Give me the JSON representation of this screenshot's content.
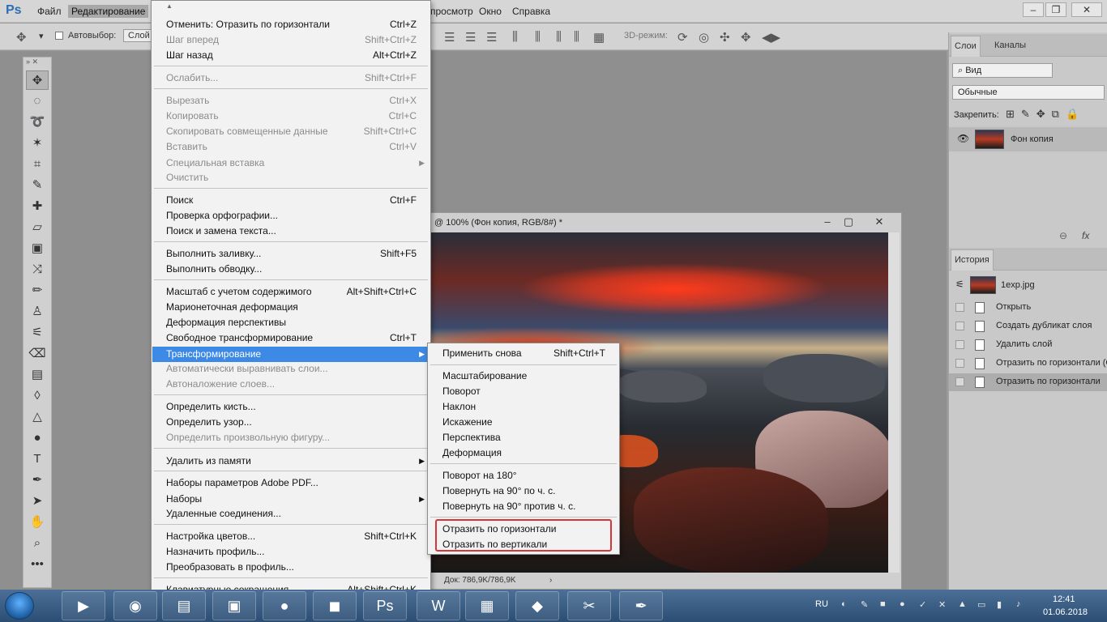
{
  "app": {
    "logo": "Ps",
    "menus": [
      "Файл",
      "Редактирование",
      "просмотр",
      "Окно",
      "Справка"
    ]
  },
  "options": {
    "autoselect": "Автовыбор:",
    "layer_select": "Слой",
    "mode_3d": "3D-режим:"
  },
  "edit_menu": {
    "items": [
      {
        "label": "Отменить: Отразить по горизонтали",
        "shortcut": "Ctrl+Z",
        "disabled": false
      },
      {
        "label": "Шаг вперед",
        "shortcut": "Shift+Ctrl+Z",
        "disabled": true
      },
      {
        "label": "Шаг назад",
        "shortcut": "Alt+Ctrl+Z",
        "disabled": false
      },
      {
        "label": "Ослабить...",
        "shortcut": "Shift+Ctrl+F",
        "disabled": true
      },
      {
        "label": "Вырезать",
        "shortcut": "Ctrl+X",
        "disabled": true
      },
      {
        "label": "Копировать",
        "shortcut": "Ctrl+C",
        "disabled": true
      },
      {
        "label": "Скопировать совмещенные данные",
        "shortcut": "Shift+Ctrl+C",
        "disabled": true
      },
      {
        "label": "Вставить",
        "shortcut": "Ctrl+V",
        "disabled": true
      },
      {
        "label": "Специальная вставка",
        "shortcut": "",
        "disabled": true
      },
      {
        "label": "Очистить",
        "shortcut": "",
        "disabled": true
      },
      {
        "label": "Поиск",
        "shortcut": "Ctrl+F",
        "disabled": false
      },
      {
        "label": "Проверка орфографии...",
        "shortcut": "",
        "disabled": false
      },
      {
        "label": "Поиск и замена текста...",
        "shortcut": "",
        "disabled": false
      },
      {
        "label": "Выполнить заливку...",
        "shortcut": "Shift+F5",
        "disabled": false
      },
      {
        "label": "Выполнить обводку...",
        "shortcut": "",
        "disabled": false
      },
      {
        "label": "Масштаб с учетом содержимого",
        "shortcut": "Alt+Shift+Ctrl+C",
        "disabled": false
      },
      {
        "label": "Марионеточная деформация",
        "shortcut": "",
        "disabled": false
      },
      {
        "label": "Деформация перспективы",
        "shortcut": "",
        "disabled": false
      },
      {
        "label": "Свободное трансформирование",
        "shortcut": "Ctrl+T",
        "disabled": false
      },
      {
        "label": "Трансформирование",
        "shortcut": "",
        "disabled": false
      },
      {
        "label": "Автоматически выравнивать слои...",
        "shortcut": "",
        "disabled": true
      },
      {
        "label": "Автоналожение слоев...",
        "shortcut": "",
        "disabled": true
      },
      {
        "label": "Определить кисть...",
        "shortcut": "",
        "disabled": false
      },
      {
        "label": "Определить узор...",
        "shortcut": "",
        "disabled": false
      },
      {
        "label": "Определить произвольную фигуру...",
        "shortcut": "",
        "disabled": true
      },
      {
        "label": "Удалить из памяти",
        "shortcut": "",
        "disabled": false
      },
      {
        "label": "Наборы параметров Adobe PDF...",
        "shortcut": "",
        "disabled": false
      },
      {
        "label": "Наборы",
        "shortcut": "",
        "disabled": false
      },
      {
        "label": "Удаленные соединения...",
        "shortcut": "",
        "disabled": false
      },
      {
        "label": "Настройка цветов...",
        "shortcut": "Shift+Ctrl+K",
        "disabled": false
      },
      {
        "label": "Назначить профиль...",
        "shortcut": "",
        "disabled": false
      },
      {
        "label": "Преобразовать в профиль...",
        "shortcut": "",
        "disabled": false
      },
      {
        "label": "Клавиатурные сокращения...",
        "shortcut": "Alt+Shift+Ctrl+K",
        "disabled": false
      }
    ]
  },
  "transform_menu": {
    "items": [
      {
        "label": "Применить снова",
        "shortcut": "Shift+Ctrl+T"
      },
      {
        "label": "Масштабирование",
        "shortcut": ""
      },
      {
        "label": "Поворот",
        "shortcut": ""
      },
      {
        "label": "Наклон",
        "shortcut": ""
      },
      {
        "label": "Искажение",
        "shortcut": ""
      },
      {
        "label": "Перспектива",
        "shortcut": ""
      },
      {
        "label": "Деформация",
        "shortcut": ""
      },
      {
        "label": "Поворот на 180°",
        "shortcut": ""
      },
      {
        "label": "Повернуть на 90° по ч. с.",
        "shortcut": ""
      },
      {
        "label": "Повернуть на 90° против ч. с.",
        "shortcut": ""
      },
      {
        "label": "Отразить по горизонтали",
        "shortcut": ""
      },
      {
        "label": "Отразить по вертикали",
        "shortcut": ""
      }
    ]
  },
  "document": {
    "title": "@ 100% (Фон копия, RGB/8#) *",
    "status": "Док: 786,9K/786,9K"
  },
  "layers_panel": {
    "tabs": [
      "Слои",
      "Каналы"
    ],
    "filter": "Вид",
    "blend_mode": "Обычные",
    "lock_label": "Закрепить:",
    "layer_name": "Фон копия"
  },
  "history_panel": {
    "tab": "История",
    "snapshot": "1exp.jpg",
    "items": [
      "Открыть",
      "Создать дубликат слоя",
      "Удалить слой",
      "Отразить по горизонтали (Со",
      "Отразить по горизонтали"
    ]
  },
  "taskbar": {
    "lang": "RU",
    "time": "12:41",
    "date": "01.06.2018"
  },
  "colors": {
    "highlight": "#3c8ae6",
    "annotation_box": "#d6363a"
  }
}
